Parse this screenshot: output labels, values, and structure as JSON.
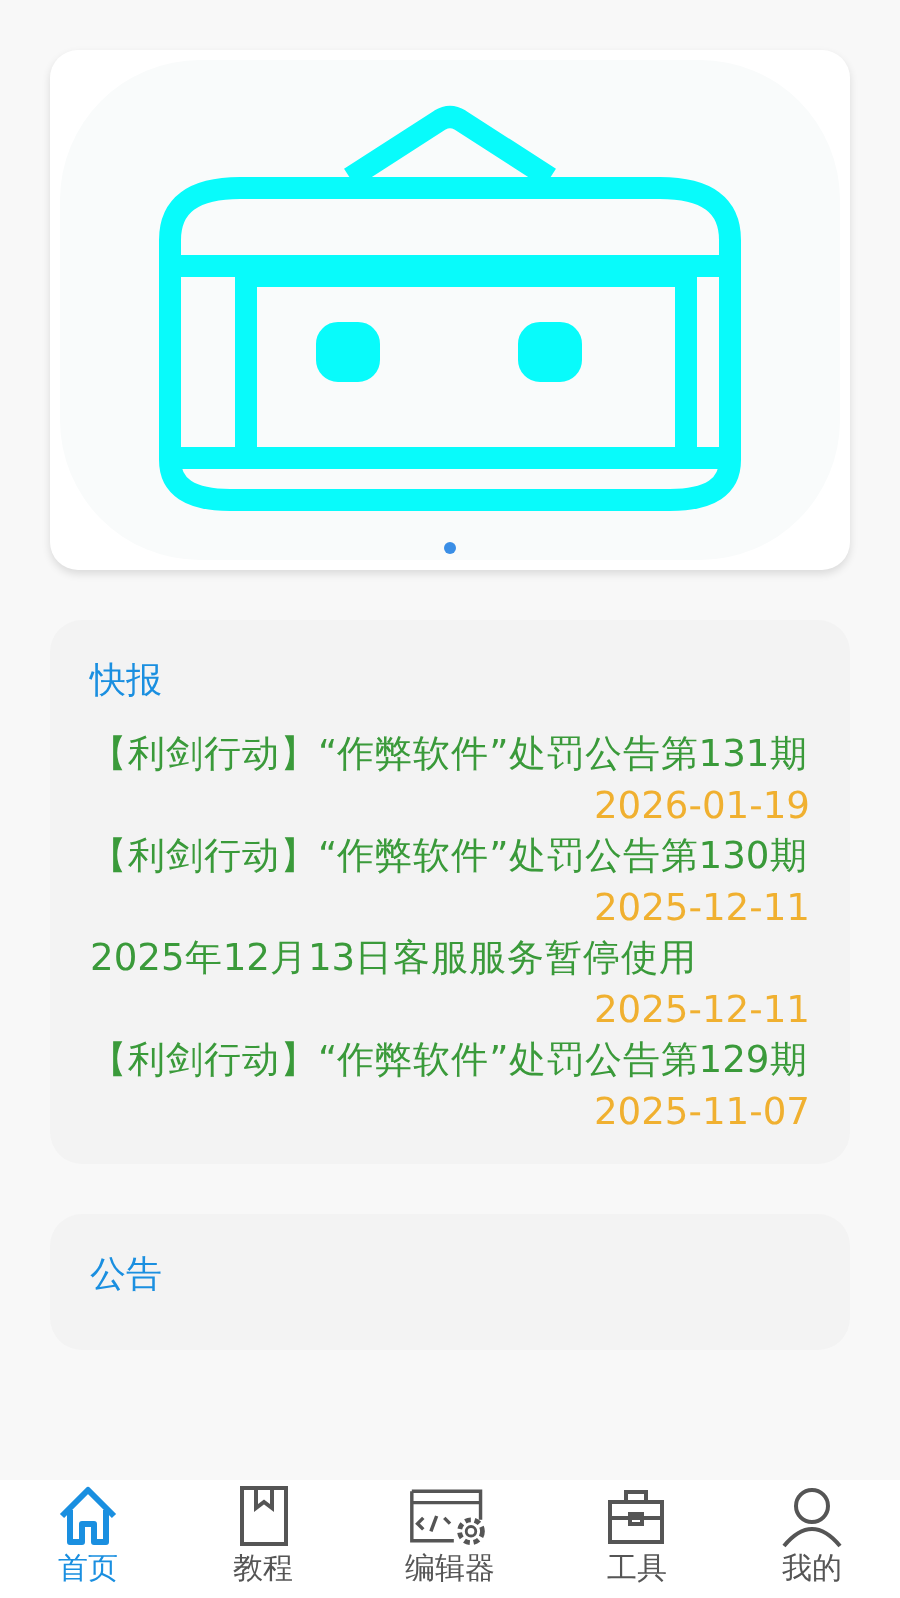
{
  "banner": {
    "indicators": [
      {
        "selected": true
      }
    ]
  },
  "news": {
    "title": "快报",
    "items": [
      {
        "text": "【利剑行动】“作弊软件”处罚公告第131期",
        "date": "2026-01-19"
      },
      {
        "text": "【利剑行动】“作弊软件”处罚公告第130期",
        "date": "2025-12-11"
      },
      {
        "text": "2025年12月13日客服服务暂停使用",
        "date": "2025-12-11"
      },
      {
        "text": "【利剑行动】“作弊软件”处罚公告第129期",
        "date": "2025-11-07"
      }
    ]
  },
  "notices": {
    "title": "公告"
  },
  "bottom_nav": [
    {
      "label": "首页",
      "selected": true
    },
    {
      "label": "教程",
      "selected": false
    },
    {
      "label": "编辑器",
      "selected": false
    },
    {
      "label": "工具",
      "selected": false
    },
    {
      "label": "我的",
      "selected": false
    }
  ]
}
